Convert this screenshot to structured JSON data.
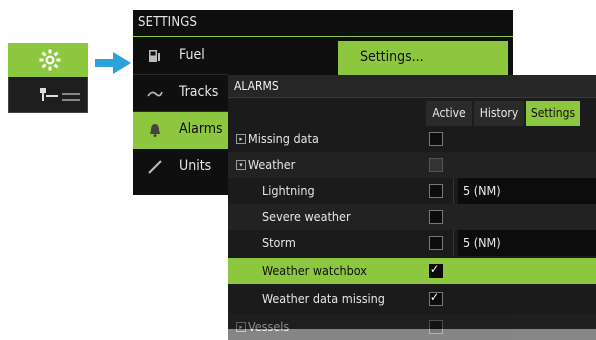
{
  "settings_menu": {
    "title": "SETTINGS",
    "items": [
      {
        "label": "Fuel",
        "icon": "fuel-icon",
        "selected": false
      },
      {
        "label": "Tracks",
        "icon": "tracks-icon",
        "selected": false
      },
      {
        "label": "Alarms",
        "icon": "bell-icon",
        "selected": true
      },
      {
        "label": "Units",
        "icon": "ruler-icon",
        "selected": false
      }
    ],
    "popup_label": "Settings..."
  },
  "alarms": {
    "title": "ALARMS",
    "tabs": [
      {
        "label": "Active",
        "selected": false
      },
      {
        "label": "History",
        "selected": false
      },
      {
        "label": "Settings",
        "selected": true
      }
    ],
    "rows": [
      {
        "label": "Missing data",
        "expander": "collapsed",
        "checked": false,
        "value": ""
      },
      {
        "label": "Weather",
        "expander": "expanded",
        "checked": false,
        "dim": true,
        "value": ""
      },
      {
        "label": "Lightning",
        "checked": false,
        "value": "5 (NM)"
      },
      {
        "label": "Severe weather",
        "checked": false,
        "value": ""
      },
      {
        "label": "Storm",
        "checked": false,
        "value": "5 (NM)"
      },
      {
        "label": "Weather watchbox",
        "checked": true,
        "selected": true,
        "value": ""
      },
      {
        "label": "Weather data missing",
        "checked": true,
        "value": ""
      },
      {
        "label": "Vessels",
        "expander": "collapsed",
        "checked": false,
        "value": ""
      }
    ]
  },
  "colors": {
    "accent": "#8dc63f",
    "panel": "#1b1b1b",
    "arrow": "#29a3d9"
  }
}
